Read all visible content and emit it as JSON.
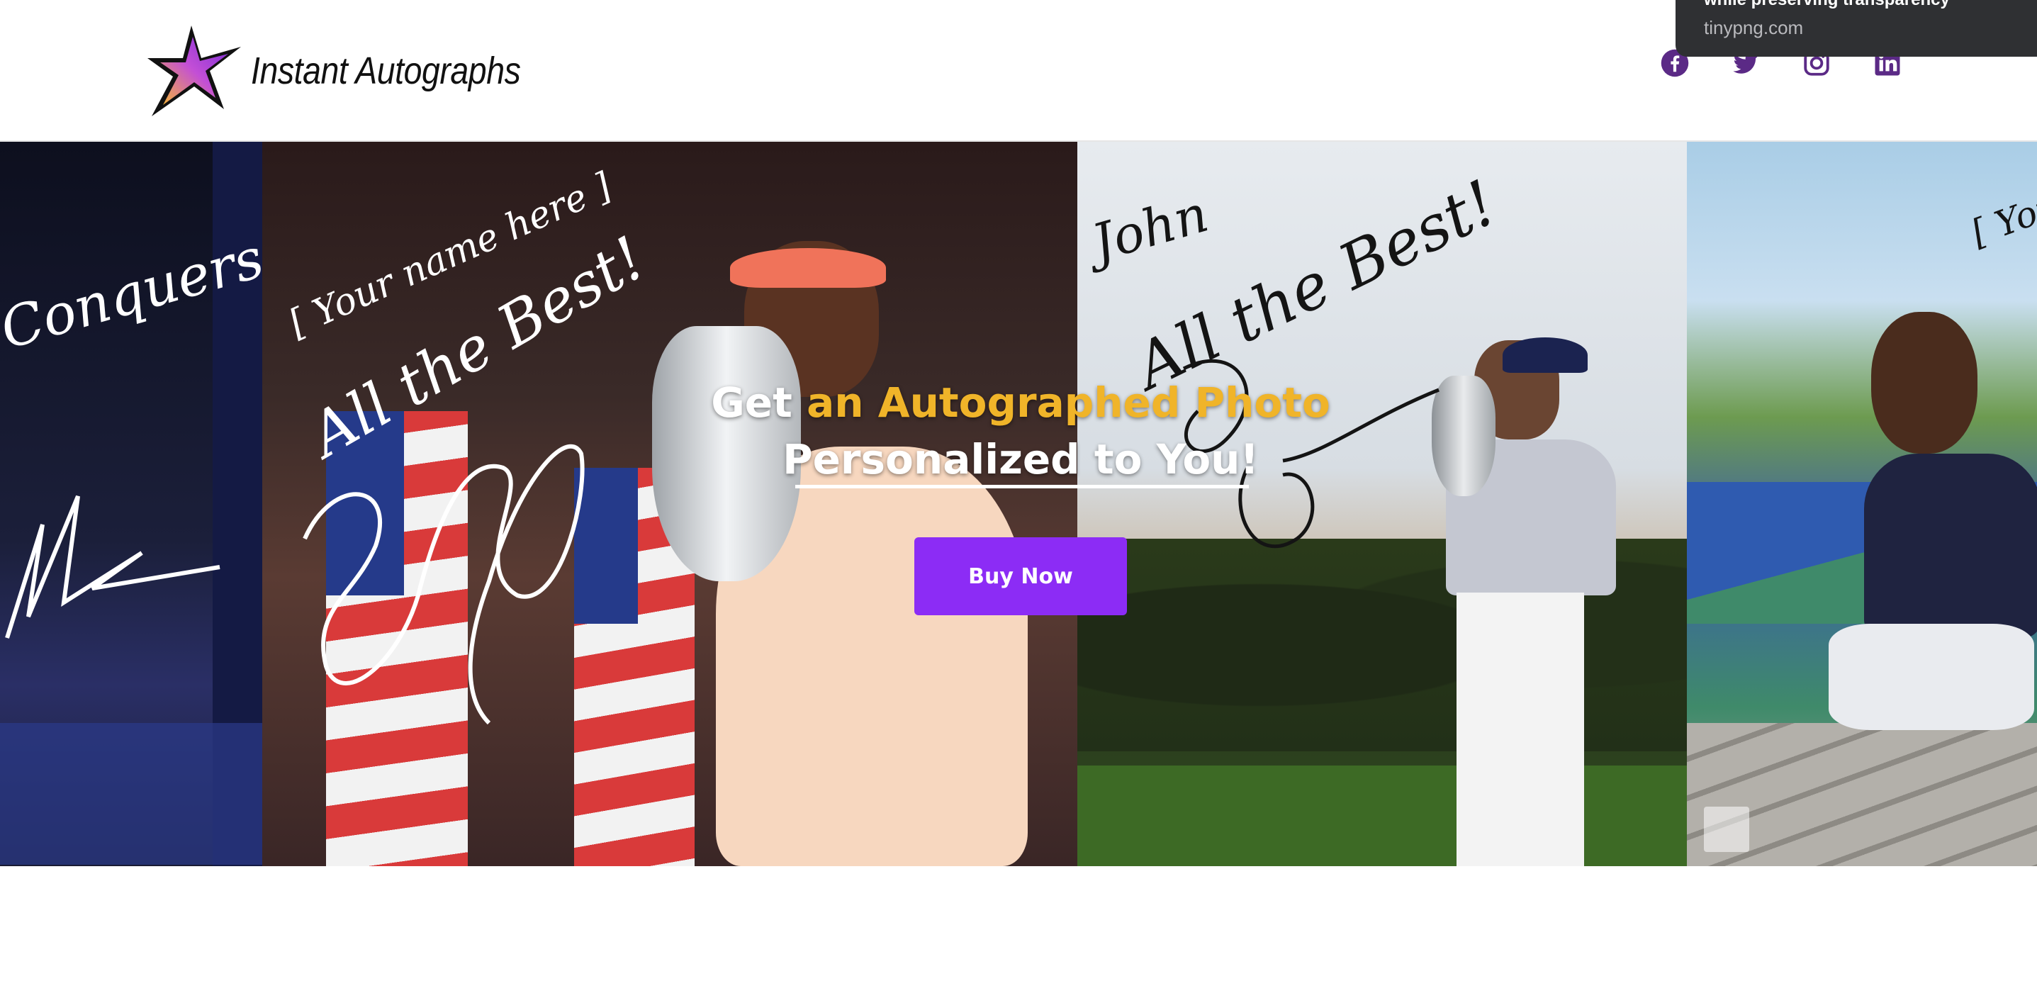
{
  "header": {
    "brand_name": "Instant Autographs",
    "logo_icon": "star-logo-icon",
    "social": [
      {
        "name": "facebook",
        "icon": "facebook-icon"
      },
      {
        "name": "twitter",
        "icon": "twitter-icon"
      },
      {
        "name": "instagram",
        "icon": "instagram-icon"
      },
      {
        "name": "linkedin",
        "icon": "linkedin-icon"
      }
    ],
    "icon_color": "#5b2a86"
  },
  "toast": {
    "title": "while preserving transparency",
    "domain": "tinypng.com"
  },
  "hero": {
    "title_part1": "Get ",
    "title_accent": "an Autographed Photo",
    "title_line2": "Personalized to You!",
    "accent_color": "#f0b429",
    "button_label": "Buy Now",
    "button_color": "#8c2cf5",
    "panels": [
      {
        "signature_texts": [
          "Conquers"
        ]
      },
      {
        "signature_texts": [
          "[ Your name here ]",
          "All the Best!"
        ]
      },
      {
        "signature_texts": [
          "John",
          "All the Best!"
        ]
      },
      {
        "signature_texts": [
          "[ You"
        ]
      }
    ]
  }
}
